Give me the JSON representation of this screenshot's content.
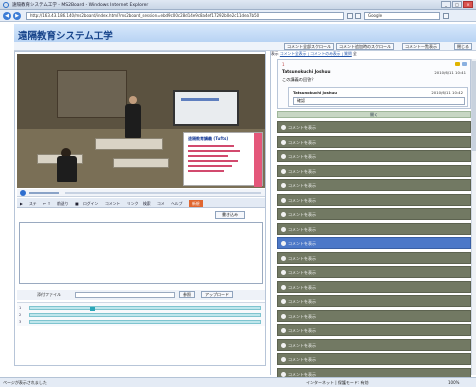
{
  "window": {
    "title": "遠隔教育システム工学 - MS2Board - Windows Internet Explorer",
    "minimize": "_",
    "maximize": "□",
    "close": "×"
  },
  "browser": {
    "back": "◀",
    "forward": "▶",
    "address": "http://163.43.186.140/ms2board/index.html?ms2board_session=ebd9c00c28d14e9c8a4ef17292b0e2c11dea7b50",
    "search_placeholder": "Google",
    "search_icon": "magnifier-icon"
  },
  "app": {
    "title": "遠隔教育システム工学",
    "toolbar": [
      "コメント全部スクロール",
      "コメント追加時のスクロール",
      "コメント一覧表示",
      "閉じる"
    ]
  },
  "video": {
    "slide_title": "遠隔教育講義 (Tufts)"
  },
  "player": {
    "play_icon": "play-icon"
  },
  "tabs": [
    "▶",
    "ステ",
    "← ↑",
    "前送り",
    "■",
    "ログイン",
    "コメント",
    "リンク",
    "検索",
    "コメ",
    "ヘルプ",
    "新規"
  ],
  "compose": {
    "post_button": "書き込み",
    "textarea_value": ""
  },
  "file": {
    "label": "添付ファイル",
    "browse": "参照",
    "upload": "アップロード"
  },
  "timeline": {
    "labels": [
      "1",
      "2",
      "3"
    ]
  },
  "right": {
    "filter_prefix": "表示",
    "filter_link": "コメント全表示 | コメントのみ表示 | 質問",
    "filter_suffix": "全",
    "thread": {
      "number": "1",
      "date": "2010/6/11 10:41",
      "name": "Tatsunokuchi Joshuu",
      "message": "この講義の回答？",
      "reply_name": "Tatsunokuchi Joshuu",
      "reply_date": "2010/6/11 10:42",
      "reply_text": "確認"
    },
    "open_bar": "開く",
    "comments": [
      {
        "label": "コメントを表示",
        "active": false
      },
      {
        "label": "コメントを表示",
        "active": false
      },
      {
        "label": "コメントを表示",
        "active": false
      },
      {
        "label": "コメントを表示",
        "active": false
      },
      {
        "label": "コメントを表示",
        "active": false
      },
      {
        "label": "コメントを表示",
        "active": false
      },
      {
        "label": "コメントを表示",
        "active": false
      },
      {
        "label": "コメントを表示",
        "active": false
      },
      {
        "label": "コメントを表示",
        "active": true
      },
      {
        "label": "コメントを表示",
        "active": false
      },
      {
        "label": "コメントを表示",
        "active": false
      },
      {
        "label": "コメントを表示",
        "active": false
      },
      {
        "label": "コメントを表示",
        "active": false
      },
      {
        "label": "コメントを表示",
        "active": false
      },
      {
        "label": "コメントを表示",
        "active": false
      },
      {
        "label": "コメントを表示",
        "active": false
      },
      {
        "label": "コメントを表示",
        "active": false
      },
      {
        "label": "コメントを表示",
        "active": false
      }
    ]
  },
  "status": {
    "left": "ページが表示されました",
    "zone": "インターネット | 保護モード: 有効",
    "zoom": "100%"
  },
  "colors": {
    "accent": "#e0662f",
    "comment_row": "#727963",
    "comment_active": "#4c78c8",
    "title_blue": "#16438a"
  }
}
